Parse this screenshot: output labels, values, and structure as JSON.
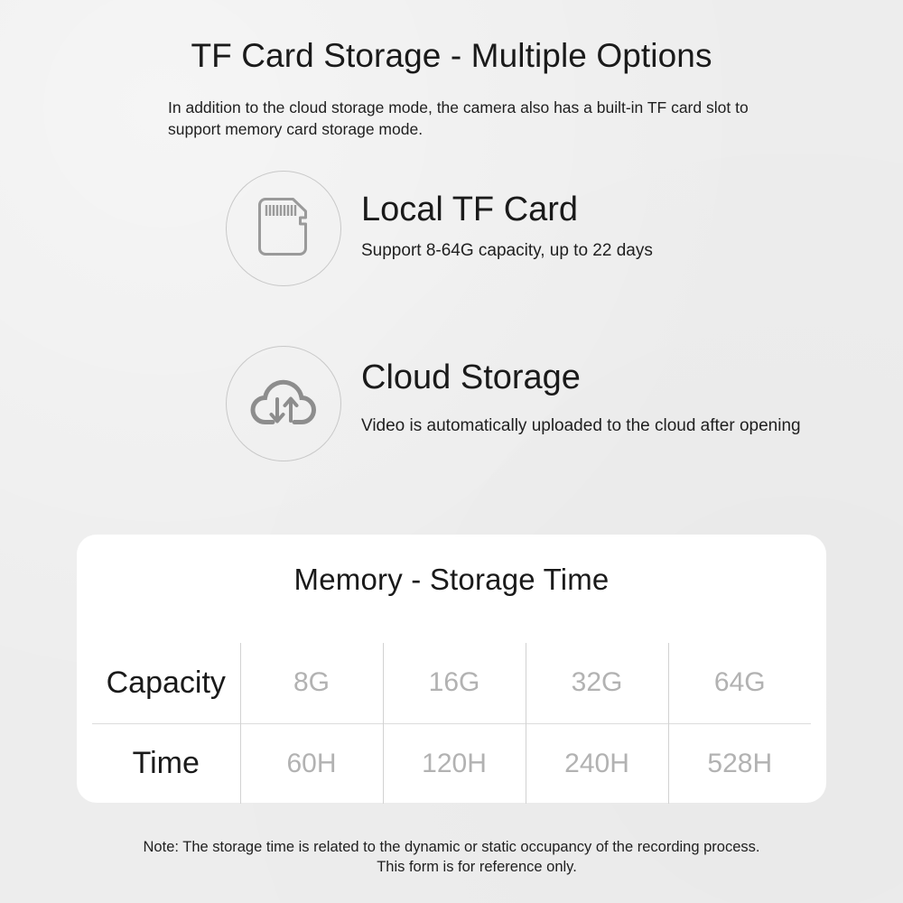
{
  "page": {
    "title": "TF Card Storage - Multiple Options",
    "subtitle": "In addition to the cloud storage mode, the camera also has a built-in TF card slot to support memory card storage mode."
  },
  "features": [
    {
      "icon": "microsd-card-icon",
      "title": "Local TF Card",
      "desc": "Support 8-64G capacity, up to 22 days"
    },
    {
      "icon": "cloud-sync-icon",
      "title": "Cloud Storage",
      "desc": "Video is automatically uploaded to the cloud after opening"
    }
  ],
  "table": {
    "title": "Memory - Storage Time",
    "rows": [
      {
        "label": "Capacity",
        "values": [
          "8G",
          "16G",
          "32G",
          "64G"
        ]
      },
      {
        "label": "Time",
        "values": [
          "60H",
          "120H",
          "240H",
          "528H"
        ]
      }
    ]
  },
  "note": {
    "line1": "Note: The storage time is related to the dynamic or static occupancy of the recording process.",
    "line2": "This form is for reference only."
  },
  "colors": {
    "background": "#ededed",
    "card": "#ffffff",
    "text_dark": "#1a1a1a",
    "text_muted": "#b2b2b2",
    "icon_stroke": "#8d8d8d",
    "ring": "#c8c8c8",
    "divider": "#d2d2d2"
  }
}
